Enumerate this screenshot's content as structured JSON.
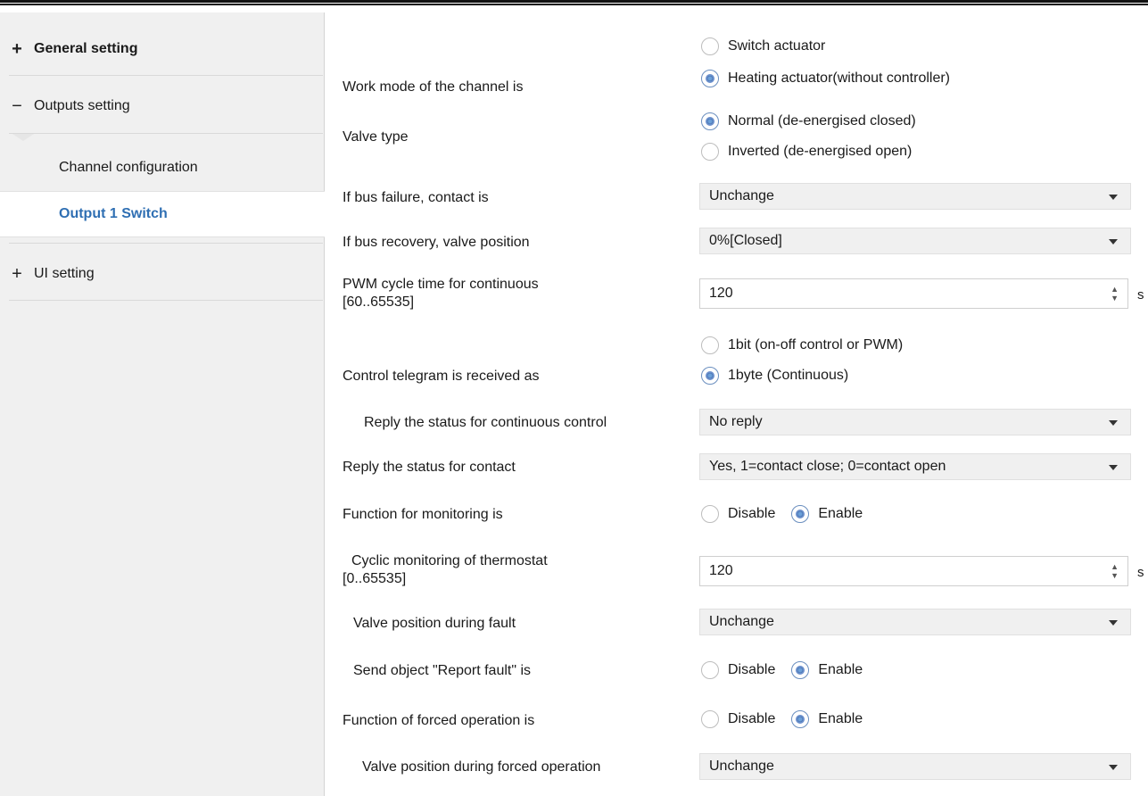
{
  "sidebar": {
    "items": [
      {
        "sign": "+",
        "label": "General setting"
      },
      {
        "sign": "−",
        "label": "Outputs setting"
      },
      {
        "sign": "",
        "label": "Channel configuration"
      },
      {
        "sign": "",
        "label": "Output 1 Switch"
      },
      {
        "sign": "+",
        "label": "UI setting"
      }
    ]
  },
  "settings": {
    "work_mode": {
      "label": "Work mode of the channel is",
      "options": [
        "Switch actuator",
        "Heating actuator(without controller)"
      ],
      "selected": "Heating actuator(without controller)"
    },
    "valve_type": {
      "label": "Valve type",
      "options": [
        "Normal (de-energised closed)",
        "Inverted (de-energised open)"
      ],
      "selected": "Normal (de-energised closed)"
    },
    "bus_failure": {
      "label": "If bus failure, contact is",
      "value": "Unchange"
    },
    "bus_recovery": {
      "label": "If bus recovery, valve position",
      "value": "0%[Closed]"
    },
    "pwm_cycle": {
      "label_line1": "PWM cycle time for continuous",
      "label_line2": "[60..65535]",
      "value": "120",
      "unit": "s"
    },
    "control_telegram": {
      "label": "Control telegram is received as",
      "options": [
        "1bit (on-off control or PWM)",
        "1byte (Continuous)"
      ],
      "selected": "1byte (Continuous)"
    },
    "reply_continuous": {
      "label": "Reply the status for continuous control",
      "value": "No reply"
    },
    "reply_contact": {
      "label": "Reply the status for contact",
      "value": "Yes, 1=contact close; 0=contact open"
    },
    "monitoring": {
      "label": "Function for monitoring is",
      "options": [
        "Disable",
        "Enable"
      ],
      "selected": "Enable"
    },
    "cyclic_monitoring": {
      "label_line1": "Cyclic monitoring of thermostat",
      "label_line2": "[0..65535]",
      "value": "120",
      "unit": "s"
    },
    "valve_fault": {
      "label": "Valve position during fault",
      "value": "Unchange"
    },
    "report_fault": {
      "label": "Send object \"Report fault\" is",
      "options": [
        "Disable",
        "Enable"
      ],
      "selected": "Enable"
    },
    "forced_operation": {
      "label": "Function of forced operation is",
      "options": [
        "Disable",
        "Enable"
      ],
      "selected": "Enable"
    },
    "valve_forced": {
      "label": "Valve position during forced operation",
      "value": "Unchange"
    }
  }
}
